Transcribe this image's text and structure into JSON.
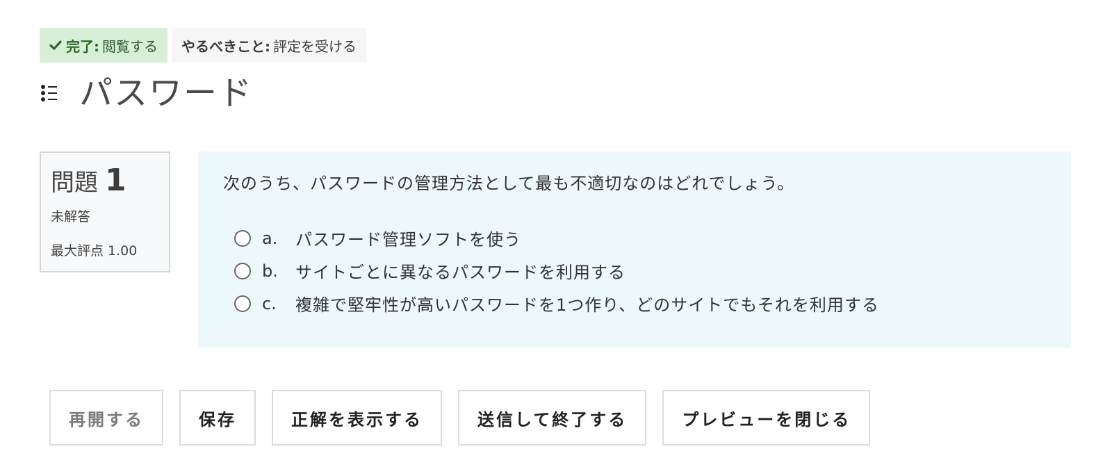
{
  "completion": {
    "done": {
      "key": "完了:",
      "value": "閲覧する"
    },
    "todo": {
      "key": "やるべきこと:",
      "value": "評定を受ける"
    }
  },
  "page": {
    "title": "パスワード"
  },
  "question": {
    "label": "問題",
    "number": "1",
    "state": "未解答",
    "max_grade": "最大評点 1.00",
    "text": "次のうち、パスワードの管理方法として最も不適切なのはどれでしょう。",
    "answers": [
      {
        "letter": "a.",
        "text": "パスワード管理ソフトを使う"
      },
      {
        "letter": "b.",
        "text": "サイトごとに異なるパスワードを利用する"
      },
      {
        "letter": "c.",
        "text": "複雑で堅牢性が高いパスワードを1つ作り、どのサイトでもそれを利用する"
      }
    ]
  },
  "buttons": {
    "restart": "再開する",
    "save": "保存",
    "show_correct": "正解を表示する",
    "submit": "送信して終了する",
    "close_preview": "プレビューを閉じる"
  },
  "colors": {
    "done_badge_bg": "#d7efd6",
    "todo_badge_bg": "#f6f6f6",
    "question_bg": "#ecf8fa",
    "info_bg": "#f8f9fa"
  }
}
